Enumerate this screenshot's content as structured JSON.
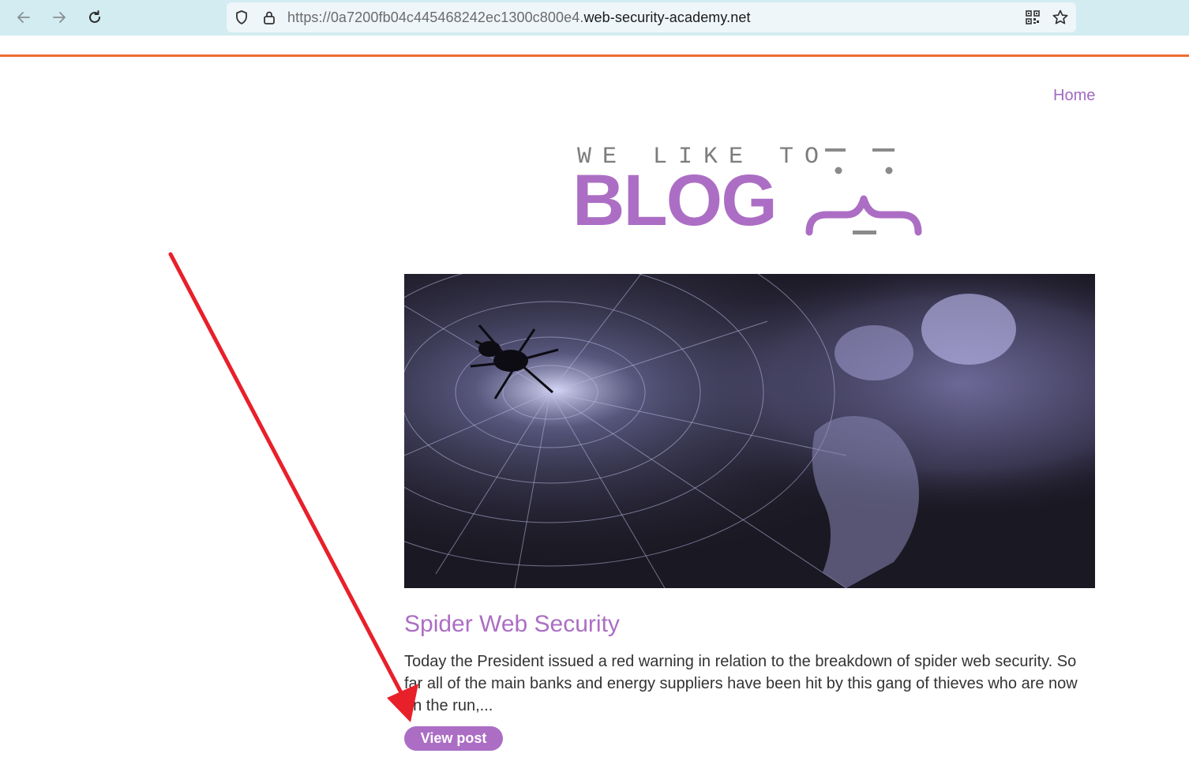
{
  "browser": {
    "url_dim_part": "https://0a7200fb04c445468242ec1300c800e4.",
    "url_domain_part": "web-security-academy.net",
    "colors": {
      "toolbar": "#d2ecf1",
      "accent_line": "#f06d34"
    }
  },
  "site": {
    "nav": {
      "home_label": "Home"
    },
    "logo": {
      "line1": "WE LIKE TO",
      "line2": "BLOG"
    },
    "brand_color": "#ac6ec4"
  },
  "post": {
    "title": "Spider Web Security",
    "summary": "Today the President issued a red warning in relation to the breakdown of spider web security. So far all of the main banks and energy suppliers have been hit by this gang of thieves who are now on the run,...",
    "button_label": "View post",
    "image_icon": "spider-web-image"
  },
  "annotation": {
    "arrow_color": "#e8202a"
  }
}
